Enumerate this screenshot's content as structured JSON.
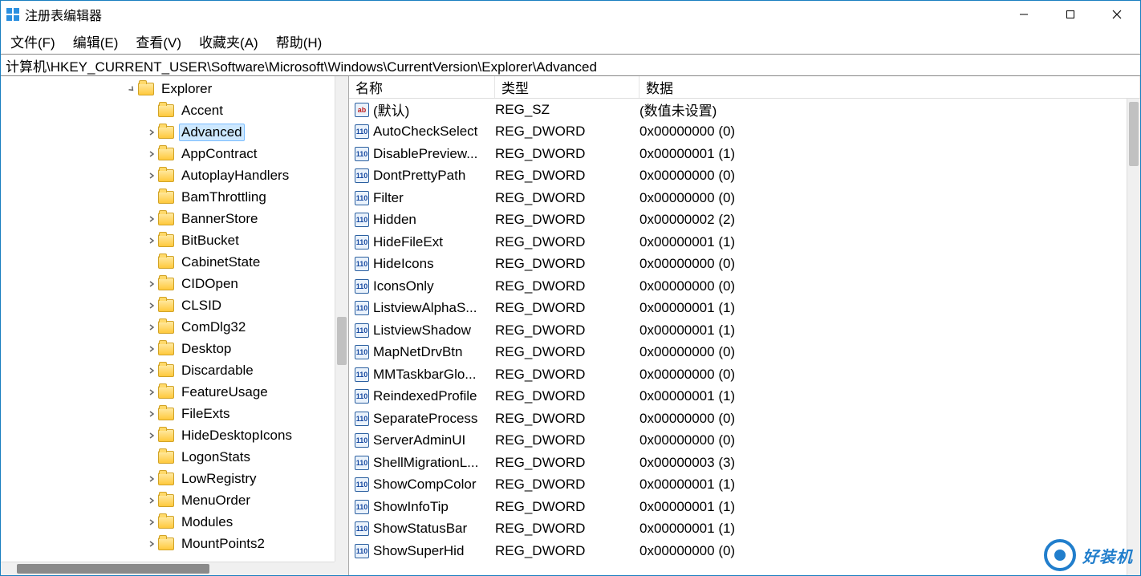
{
  "window": {
    "title": "注册表编辑器"
  },
  "menubar": {
    "file": "文件(F)",
    "edit": "编辑(E)",
    "view": "查看(V)",
    "favorites": "收藏夹(A)",
    "help": "帮助(H)"
  },
  "addressbar": {
    "path": "计算机\\HKEY_CURRENT_USER\\Software\\Microsoft\\Windows\\CurrentVersion\\Explorer\\Advanced"
  },
  "tree": {
    "root_label": "Explorer",
    "items": [
      {
        "label": "Accent",
        "expander": false
      },
      {
        "label": "Advanced",
        "expander": true,
        "selected": true
      },
      {
        "label": "AppContract",
        "expander": true
      },
      {
        "label": "AutoplayHandlers",
        "expander": true
      },
      {
        "label": "BamThrottling",
        "expander": false
      },
      {
        "label": "BannerStore",
        "expander": true
      },
      {
        "label": "BitBucket",
        "expander": true
      },
      {
        "label": "CabinetState",
        "expander": false
      },
      {
        "label": "CIDOpen",
        "expander": true
      },
      {
        "label": "CLSID",
        "expander": true
      },
      {
        "label": "ComDlg32",
        "expander": true
      },
      {
        "label": "Desktop",
        "expander": true
      },
      {
        "label": "Discardable",
        "expander": true
      },
      {
        "label": "FeatureUsage",
        "expander": true
      },
      {
        "label": "FileExts",
        "expander": true
      },
      {
        "label": "HideDesktopIcons",
        "expander": true
      },
      {
        "label": "LogonStats",
        "expander": false
      },
      {
        "label": "LowRegistry",
        "expander": true
      },
      {
        "label": "MenuOrder",
        "expander": true
      },
      {
        "label": "Modules",
        "expander": true
      },
      {
        "label": "MountPoints2",
        "expander": true
      }
    ]
  },
  "columns": {
    "name": "名称",
    "type": "类型",
    "data": "数据"
  },
  "values": [
    {
      "icon": "sz",
      "name": "(默认)",
      "type": "REG_SZ",
      "data": "(数值未设置)"
    },
    {
      "icon": "dw",
      "name": "AutoCheckSelect",
      "type": "REG_DWORD",
      "data": "0x00000000 (0)"
    },
    {
      "icon": "dw",
      "name": "DisablePreview...",
      "type": "REG_DWORD",
      "data": "0x00000001 (1)"
    },
    {
      "icon": "dw",
      "name": "DontPrettyPath",
      "type": "REG_DWORD",
      "data": "0x00000000 (0)"
    },
    {
      "icon": "dw",
      "name": "Filter",
      "type": "REG_DWORD",
      "data": "0x00000000 (0)"
    },
    {
      "icon": "dw",
      "name": "Hidden",
      "type": "REG_DWORD",
      "data": "0x00000002 (2)"
    },
    {
      "icon": "dw",
      "name": "HideFileExt",
      "type": "REG_DWORD",
      "data": "0x00000001 (1)"
    },
    {
      "icon": "dw",
      "name": "HideIcons",
      "type": "REG_DWORD",
      "data": "0x00000000 (0)"
    },
    {
      "icon": "dw",
      "name": "IconsOnly",
      "type": "REG_DWORD",
      "data": "0x00000000 (0)"
    },
    {
      "icon": "dw",
      "name": "ListviewAlphaS...",
      "type": "REG_DWORD",
      "data": "0x00000001 (1)"
    },
    {
      "icon": "dw",
      "name": "ListviewShadow",
      "type": "REG_DWORD",
      "data": "0x00000001 (1)"
    },
    {
      "icon": "dw",
      "name": "MapNetDrvBtn",
      "type": "REG_DWORD",
      "data": "0x00000000 (0)"
    },
    {
      "icon": "dw",
      "name": "MMTaskbarGlo...",
      "type": "REG_DWORD",
      "data": "0x00000000 (0)"
    },
    {
      "icon": "dw",
      "name": "ReindexedProfile",
      "type": "REG_DWORD",
      "data": "0x00000001 (1)"
    },
    {
      "icon": "dw",
      "name": "SeparateProcess",
      "type": "REG_DWORD",
      "data": "0x00000000 (0)"
    },
    {
      "icon": "dw",
      "name": "ServerAdminUI",
      "type": "REG_DWORD",
      "data": "0x00000000 (0)"
    },
    {
      "icon": "dw",
      "name": "ShellMigrationL...",
      "type": "REG_DWORD",
      "data": "0x00000003 (3)"
    },
    {
      "icon": "dw",
      "name": "ShowCompColor",
      "type": "REG_DWORD",
      "data": "0x00000001 (1)"
    },
    {
      "icon": "dw",
      "name": "ShowInfoTip",
      "type": "REG_DWORD",
      "data": "0x00000001 (1)"
    },
    {
      "icon": "dw",
      "name": "ShowStatusBar",
      "type": "REG_DWORD",
      "data": "0x00000001 (1)"
    },
    {
      "icon": "dw",
      "name": "ShowSuperHid",
      "type": "REG_DWORD",
      "data": "0x00000000 (0)"
    }
  ],
  "watermark": {
    "text": "好装机"
  }
}
